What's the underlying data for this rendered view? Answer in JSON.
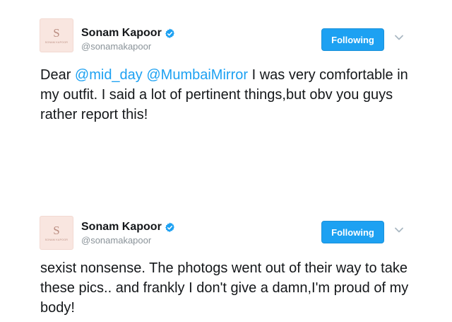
{
  "tweets": [
    {
      "avatar_mark": "S",
      "avatar_caption": "SONAM KAPOOR",
      "display_name": "Sonam Kapoor",
      "handle": "@sonamakapoor",
      "follow_label": "Following",
      "text_prefix": "Dear ",
      "mention_1": "@mid_day",
      "text_space": " ",
      "mention_2": "@MumbaiMirror",
      "text_rest": " I was very comfortable in my outfit. I said a lot of pertinent things,but obv you guys rather report this!"
    },
    {
      "avatar_mark": "S",
      "avatar_caption": "SONAM KAPOOR",
      "display_name": "Sonam Kapoor",
      "handle": "@sonamakapoor",
      "follow_label": "Following",
      "text": "sexist nonsense. The photogs went out of their way to take these pics.. and frankly I don't give a damn,I'm proud of my body!"
    }
  ],
  "colors": {
    "accent": "#1da1f2",
    "verified": "#1da1f2",
    "handle": "#8a9399",
    "avatar_bg": "#f9e6e0"
  },
  "icons": {
    "verified": "verified-badge-icon",
    "caret": "chevron-down-icon"
  }
}
